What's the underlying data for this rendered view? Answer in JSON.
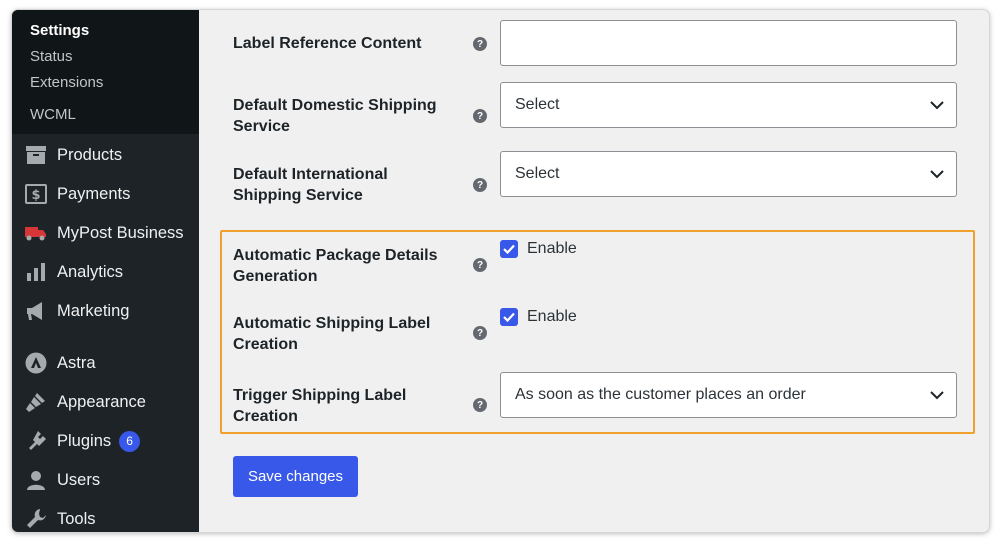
{
  "sidebar": {
    "submenu": [
      "Settings",
      "Status",
      "Extensions",
      "WCML"
    ],
    "items": [
      {
        "label": "Products",
        "icon": "archive-icon"
      },
      {
        "label": "Payments",
        "icon": "dollar-icon"
      },
      {
        "label": "MyPost Business",
        "icon": "truck-icon"
      },
      {
        "label": "Analytics",
        "icon": "bar-chart-icon"
      },
      {
        "label": "Marketing",
        "icon": "megaphone-icon"
      },
      {
        "label": "Astra",
        "icon": "astra-icon"
      },
      {
        "label": "Appearance",
        "icon": "paintbrush-icon"
      },
      {
        "label": "Plugins",
        "icon": "plugin-icon",
        "badge": "6"
      },
      {
        "label": "Users",
        "icon": "user-icon"
      },
      {
        "label": "Tools",
        "icon": "wrench-icon"
      }
    ]
  },
  "form": {
    "label_reference": {
      "label": "Label Reference Content",
      "value": ""
    },
    "domestic": {
      "label": "Default Domestic Shipping Service",
      "value": "Select"
    },
    "international": {
      "label": "Default International Shipping Service",
      "value": "Select"
    },
    "auto_package": {
      "label": "Automatic Package Details Generation",
      "checkbox_label": "Enable",
      "checked": true
    },
    "auto_label": {
      "label": "Automatic Shipping Label Creation",
      "checkbox_label": "Enable",
      "checked": true
    },
    "trigger": {
      "label": "Trigger Shipping Label Creation",
      "value": "As soon as the customer places an order"
    },
    "help_glyph": "?",
    "save_label": "Save changes"
  },
  "colors": {
    "accent": "#3858e9",
    "highlight": "#f0a02c",
    "sidebar_bg": "#1d2327"
  }
}
